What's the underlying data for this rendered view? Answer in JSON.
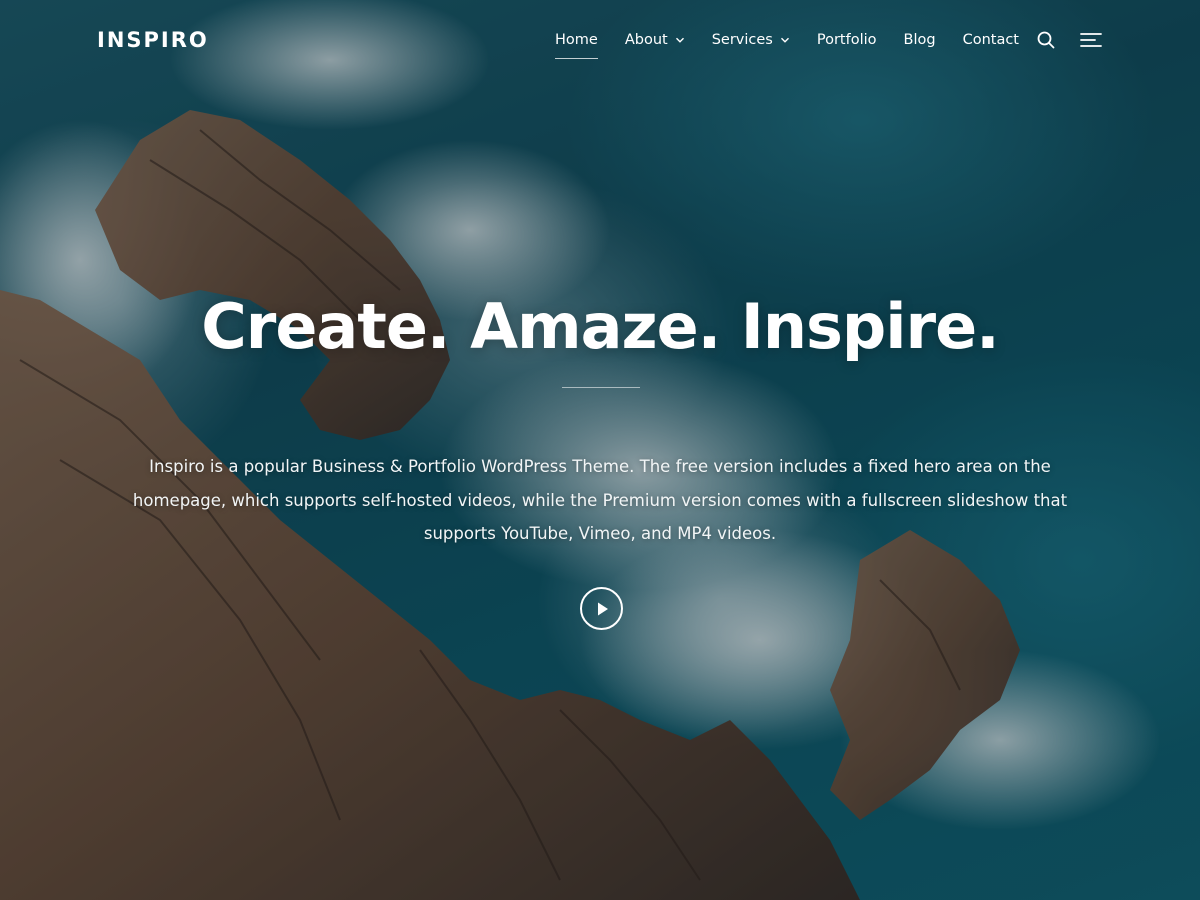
{
  "site": {
    "logo": "INSPIRO"
  },
  "nav": {
    "items": [
      {
        "label": "Home",
        "active": true,
        "dropdown": false
      },
      {
        "label": "About",
        "active": false,
        "dropdown": true
      },
      {
        "label": "Services",
        "active": false,
        "dropdown": true
      },
      {
        "label": "Portfolio",
        "active": false,
        "dropdown": false
      },
      {
        "label": "Blog",
        "active": false,
        "dropdown": false
      },
      {
        "label": "Contact",
        "active": false,
        "dropdown": false
      }
    ],
    "icons": [
      "search-icon",
      "menu-icon",
      "chevron-down-icon"
    ]
  },
  "hero": {
    "title": "Create. Amaze. Inspire.",
    "description": "Inspiro is a popular Business & Portfolio WordPress Theme. The free version includes a fixed hero area on the homepage, which supports self-hosted videos, while the Premium version comes with a fullscreen slideshow that supports YouTube, Vimeo, and MP4 videos.",
    "play_icon": "play-icon"
  },
  "colors": {
    "text": "#ffffff",
    "ocean": "#0f4c5c",
    "rock": "#6b4a35"
  }
}
